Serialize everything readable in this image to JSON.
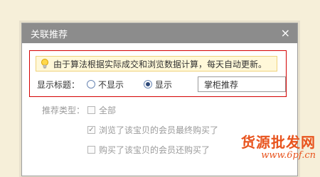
{
  "dialog": {
    "title": "关联推荐",
    "close_label": "×"
  },
  "notice": {
    "icon": "lightbulb-icon",
    "text": "由于算法根据实际成交和浏览数据计算，每天自动更新。"
  },
  "display_title": {
    "label": "显示标题：",
    "options": [
      {
        "label": "不显示",
        "selected": false
      },
      {
        "label": "显示",
        "selected": true
      }
    ],
    "input_value": "掌柜推荐"
  },
  "recommend_type": {
    "label": "推荐类型：",
    "options": [
      {
        "label": "全部",
        "checked": false
      },
      {
        "label": "浏览了该宝贝的会员最终购买了",
        "checked": true
      },
      {
        "label": "购买了该宝贝的会员还购买了",
        "checked": false
      }
    ]
  },
  "watermark": {
    "line1": "货源批发网",
    "line2": "www.6pf.cn"
  },
  "colors": {
    "highlight_border": "#d40000",
    "titlebar": "#8c8c8c",
    "notice_bg": "#fff8d9",
    "watermark": "#e8541e"
  }
}
